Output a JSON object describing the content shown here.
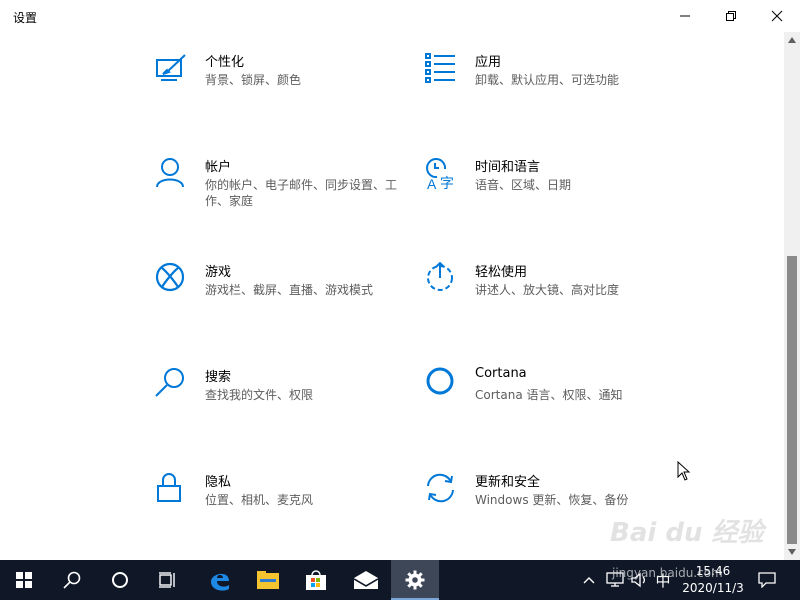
{
  "window": {
    "title": "设置"
  },
  "tiles": [
    {
      "icon": "personalization-icon",
      "name": "个性化",
      "desc": "背景、锁屏、颜色"
    },
    {
      "icon": "apps-icon",
      "name": "应用",
      "desc": "卸载、默认应用、可选功能"
    },
    {
      "icon": "account-icon",
      "name": "帐户",
      "desc": "你的帐户、电子邮件、同步设置、工作、家庭"
    },
    {
      "icon": "time-language-icon",
      "name": "时间和语言",
      "desc": "语音、区域、日期"
    },
    {
      "icon": "xbox-icon",
      "name": "游戏",
      "desc": "游戏栏、截屏、直播、游戏模式"
    },
    {
      "icon": "ease-of-access-icon",
      "name": "轻松使用",
      "desc": "讲述人、放大镜、高对比度"
    },
    {
      "icon": "search-icon",
      "name": "搜索",
      "desc": "查找我的文件、权限"
    },
    {
      "icon": "cortana-icon",
      "name": "Cortana",
      "desc": "Cortana 语言、权限、通知"
    },
    {
      "icon": "privacy-lock-icon",
      "name": "隐私",
      "desc": "位置、相机、麦克风"
    },
    {
      "icon": "update-security-icon",
      "name": "更新和安全",
      "desc": "Windows 更新、恢复、备份"
    }
  ],
  "taskbar": {
    "clock_time": "15:46",
    "clock_date": "2020/11/3",
    "ime": "中",
    "apps": [
      "start-icon",
      "search-icon",
      "cortana-icon",
      "task-view-icon",
      "edge-icon",
      "file-explorer-icon",
      "store-icon",
      "mail-icon",
      "settings-icon"
    ]
  },
  "watermark": {
    "logo": "Bai du 经验",
    "url": "jingyan.baidu.com"
  },
  "colors": {
    "accent": "#0078d7",
    "taskbar": "#101828"
  }
}
